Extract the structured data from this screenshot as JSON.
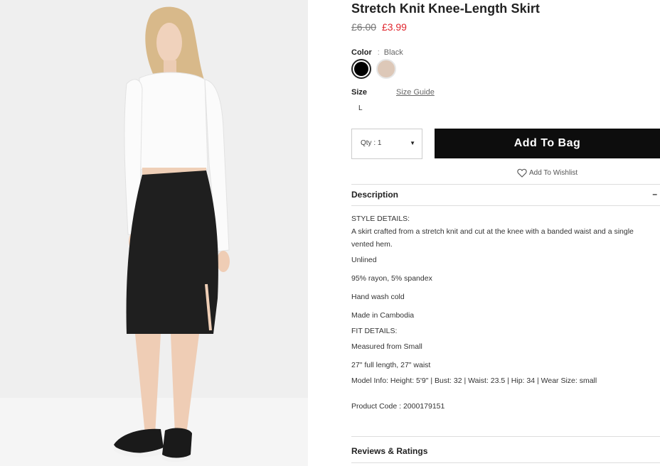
{
  "product": {
    "title": "Stretch Knit Knee-Length Skirt",
    "old_price": "£6.00",
    "new_price": "£3.99"
  },
  "color": {
    "label": "Color",
    "separator": ":",
    "selected": "Black",
    "swatches": [
      "#000000",
      "#ddc8b8"
    ]
  },
  "size": {
    "label": "Size",
    "guide_link": "Size Guide",
    "options": [
      "L"
    ]
  },
  "quantity": {
    "label": "Qty : 1"
  },
  "actions": {
    "add_to_bag": "Add To Bag",
    "wishlist": "Add To Wishlist"
  },
  "description": {
    "heading": "Description",
    "toggle": "–",
    "style_heading": "STYLE DETAILS:",
    "summary": "A skirt crafted from a stretch knit and cut at the knee with a banded waist and a single vented hem.",
    "details": [
      "Unlined",
      "95% rayon, 5% spandex",
      "Hand wash cold",
      "Made in Cambodia"
    ],
    "fit_heading": "FIT DETAILS:",
    "fit": [
      "Measured from Small",
      "27\" full length, 27\" waist"
    ],
    "model_info": "Model Info: Height: 5'9\" | Bust: 32 | Waist: 23.5 | Hip: 34 | Wear Size: small",
    "product_code": "Product Code : 2000179151"
  },
  "reviews": {
    "heading": "Reviews & Ratings"
  },
  "colors": {
    "accent_price": "#e0262e",
    "button_bg": "#0d0d0d"
  }
}
